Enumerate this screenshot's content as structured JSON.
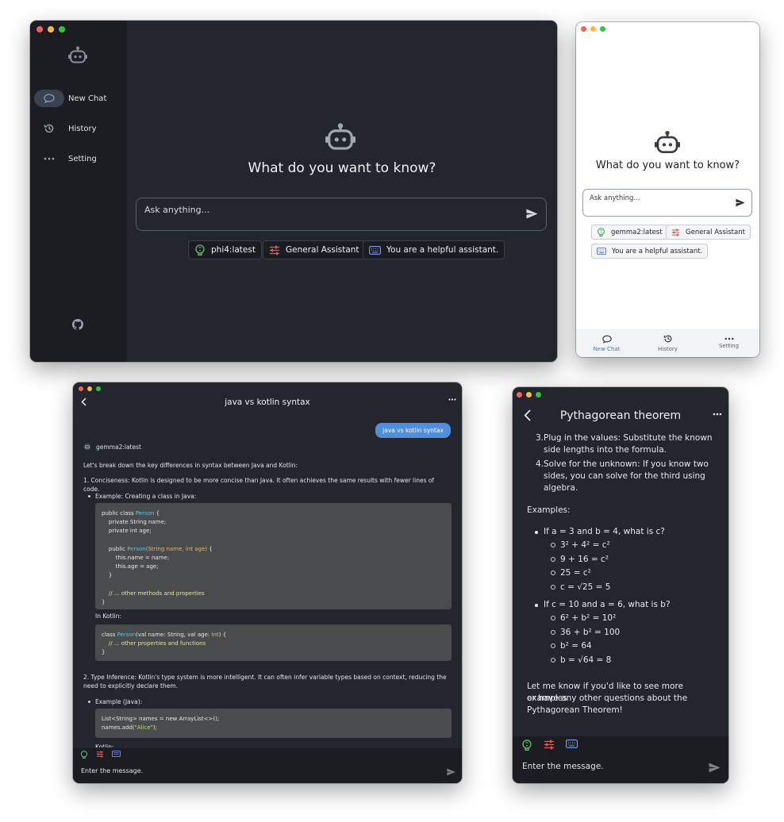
{
  "desktop": {
    "nav": {
      "new_chat": "New Chat",
      "history": "History",
      "setting": "Setting"
    },
    "heading": "What do you want to know?",
    "input_placeholder": "Ask anything...",
    "chips": {
      "model": "phi4:latest",
      "assistant": "General Assistant",
      "system_prompt": "You are a helpful assistant."
    },
    "icons": [
      "robot-icon",
      "chat-bubble-icon",
      "history-icon",
      "more-dots-icon",
      "github-icon",
      "send-icon",
      "brain-icon",
      "sliders-icon",
      "keyboard-icon"
    ]
  },
  "mobile": {
    "heading": "What do you want to know?",
    "input_placeholder": "Ask anything...",
    "chips": {
      "model": "gemma2:latest",
      "assistant": "General Assistant",
      "system_prompt": "You are a helpful assistant."
    },
    "tabs": {
      "new_chat": "New Chat",
      "history": "History",
      "setting": "Setting"
    },
    "active_tab_color": "#3b78c4"
  },
  "java_chat": {
    "title": "java vs kotlin syntax",
    "user_message": "java vs kotlin syntax",
    "assistant_name": "gemma2:latest",
    "intro": "Let's break down the key differences in syntax between Java and Kotlin:",
    "point1": "1. Conciseness:  Kotlin is designed to be more concise than Java. It often achieves the same results with fewer lines of code.",
    "example1_label": "Example: Creating a class in Java:",
    "java_code": {
      "l1a": "public class ",
      "l1b": "Person",
      "l1c": " {",
      "l2": "    private String name;",
      "l3": "    private int age;",
      "l5a": "    public ",
      "l5b": "Person",
      "l5c": "(String name, int age)",
      "l5d": " {",
      "l6": "        this.name = name;",
      "l7": "        this.age = age;",
      "l8": "    }",
      "l10": "    // ... other methods and properties",
      "l11": "}"
    },
    "in_kotlin": "In Kotlin:",
    "kotlin_code": {
      "l1a": "class ",
      "l1b": "Person",
      "l1c": "(val name: String, val age: ",
      "l1d": "Int",
      "l1e": ") {",
      "l2": "    // ... other properties and functions",
      "l3": "}"
    },
    "point2": "2. Type Inference:  Kotlin's type system is more intelligent. It can often infer variable types based on context, reducing the need to explicitly declare them.",
    "example2_label": "Example (Java):",
    "java_code2": {
      "l1": "List<String> names = new ArrayList<>();",
      "l2a": "names.add(",
      "l2b": "\"Alice\"",
      "l2c": ");"
    },
    "cut_label": "Kotlin:",
    "composer_placeholder": "Enter the message."
  },
  "pythagoras_chat": {
    "title": "Pythagorean theorem",
    "step3": "3.Plug in the values: Substitute the known side lengths into the formula.",
    "step3_l1": "3.Plug in the values: Substitute the known",
    "step3_l2": "side lengths into the formula.",
    "step4_l1": "4.Solve for the unknown:  If you know two",
    "step4_l2": "sides, you can solve for the third using",
    "step4_l3": "algebra.",
    "examples_label": "Examples:",
    "ex1": "If a = 3 and b = 4, what is c?",
    "ex1_steps": [
      "3² + 4² = c²",
      "9 + 16 = c²",
      "25 = c²",
      "c = √25 = 5"
    ],
    "ex2": "If c = 10 and a = 6, what is b?",
    "ex2_steps": [
      "6² + b² = 10²",
      "36 + b² = 100",
      "b² = 64",
      "b = √64 = 8"
    ],
    "closing_l1": "Let me know if you'd like to see more examples",
    "closing_l2": "or have any other questions about the",
    "closing_l3": "Pythagorean Theorem!",
    "composer_placeholder": "Enter the message."
  },
  "colors": {
    "dark_bg": "#23262d",
    "sidebar_bg": "#1b1d22",
    "brain_green": "#5cc86a",
    "sliders_red": "#e45a5a",
    "keyboard_blue": "#7a8cf0",
    "user_bubble": "#4f8fe0"
  }
}
